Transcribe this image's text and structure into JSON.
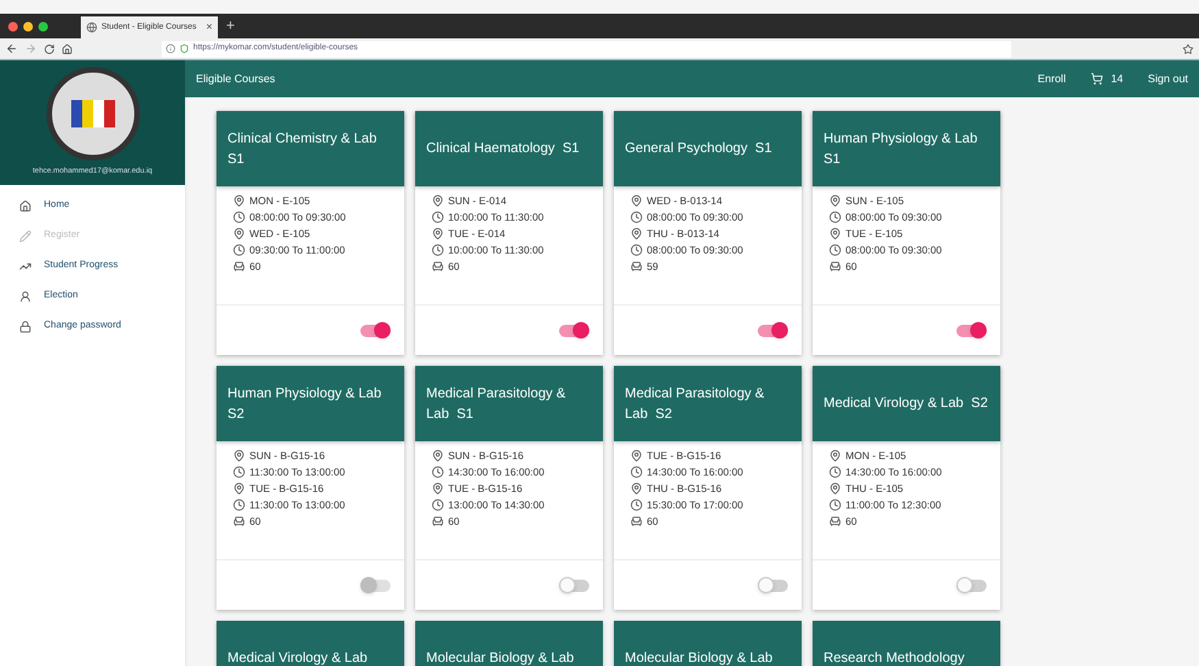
{
  "browser": {
    "tab_title": "Student - Eligible Courses",
    "tab_close": "×",
    "new_tab": "+",
    "url": "https://mykomar.com/student/eligible-courses"
  },
  "sidebar": {
    "email": "tehce.mohammed17@komar.edu.iq",
    "items": [
      {
        "label": "Home",
        "disabled": false
      },
      {
        "label": "Register",
        "disabled": true
      },
      {
        "label": "Student Progress",
        "disabled": false
      },
      {
        "label": "Election",
        "disabled": false
      },
      {
        "label": "Change password",
        "disabled": false
      }
    ]
  },
  "appbar": {
    "title": "Eligible Courses",
    "enroll": "Enroll",
    "cart_count": "14",
    "sign_out": "Sign out"
  },
  "courses": [
    {
      "title": "Clinical Chemistry & Lab  S1",
      "lines": [
        {
          "kind": "place",
          "text": "MON - E-105"
        },
        {
          "kind": "time",
          "text": "08:00:00 To 09:30:00"
        },
        {
          "kind": "place",
          "text": "WED - E-105"
        },
        {
          "kind": "time",
          "text": "09:30:00 To 11:00:00"
        },
        {
          "kind": "seats",
          "text": "60"
        }
      ],
      "on": true,
      "disabled": false
    },
    {
      "title": "Clinical Haematology  S1",
      "lines": [
        {
          "kind": "place",
          "text": "SUN - E-014"
        },
        {
          "kind": "time",
          "text": "10:00:00 To 11:30:00"
        },
        {
          "kind": "place",
          "text": "TUE - E-014"
        },
        {
          "kind": "time",
          "text": "10:00:00 To 11:30:00"
        },
        {
          "kind": "seats",
          "text": "60"
        }
      ],
      "on": true,
      "disabled": false
    },
    {
      "title": "General Psychology  S1",
      "lines": [
        {
          "kind": "place",
          "text": "WED - B-013-14"
        },
        {
          "kind": "time",
          "text": "08:00:00 To 09:30:00"
        },
        {
          "kind": "place",
          "text": "THU - B-013-14"
        },
        {
          "kind": "time",
          "text": "08:00:00 To 09:30:00"
        },
        {
          "kind": "seats",
          "text": "59"
        }
      ],
      "on": true,
      "disabled": false
    },
    {
      "title": "Human Physiology & Lab  S1",
      "lines": [
        {
          "kind": "place",
          "text": "SUN - E-105"
        },
        {
          "kind": "time",
          "text": "08:00:00 To 09:30:00"
        },
        {
          "kind": "place",
          "text": "TUE - E-105"
        },
        {
          "kind": "time",
          "text": "08:00:00 To 09:30:00"
        },
        {
          "kind": "seats",
          "text": "60"
        }
      ],
      "on": true,
      "disabled": false
    },
    {
      "title": "Human Physiology & Lab  S2",
      "lines": [
        {
          "kind": "place",
          "text": "SUN - B-G15-16"
        },
        {
          "kind": "time",
          "text": "11:30:00 To 13:00:00"
        },
        {
          "kind": "place",
          "text": "TUE - B-G15-16"
        },
        {
          "kind": "time",
          "text": "11:30:00 To 13:00:00"
        },
        {
          "kind": "seats",
          "text": "60"
        }
      ],
      "on": false,
      "disabled": true
    },
    {
      "title": "Medical Parasitology & Lab  S1",
      "lines": [
        {
          "kind": "place",
          "text": "SUN - B-G15-16"
        },
        {
          "kind": "time",
          "text": "14:30:00 To 16:00:00"
        },
        {
          "kind": "place",
          "text": "TUE - B-G15-16"
        },
        {
          "kind": "time",
          "text": "13:00:00 To 14:30:00"
        },
        {
          "kind": "seats",
          "text": "60"
        }
      ],
      "on": false,
      "disabled": false
    },
    {
      "title": "Medical Parasitology & Lab  S2",
      "lines": [
        {
          "kind": "place",
          "text": "TUE - B-G15-16"
        },
        {
          "kind": "time",
          "text": "14:30:00 To 16:00:00"
        },
        {
          "kind": "place",
          "text": "THU - B-G15-16"
        },
        {
          "kind": "time",
          "text": "15:30:00 To 17:00:00"
        },
        {
          "kind": "seats",
          "text": "60"
        }
      ],
      "on": false,
      "disabled": false
    },
    {
      "title": "Medical Virology & Lab  S2",
      "lines": [
        {
          "kind": "place",
          "text": "MON - E-105"
        },
        {
          "kind": "time",
          "text": "14:30:00 To 16:00:00"
        },
        {
          "kind": "place",
          "text": "THU - E-105"
        },
        {
          "kind": "time",
          "text": "11:00:00 To 12:30:00"
        },
        {
          "kind": "seats",
          "text": "60"
        }
      ],
      "on": false,
      "disabled": false
    },
    {
      "title": "Medical Virology & Lab"
    },
    {
      "title": "Molecular Biology & Lab"
    },
    {
      "title": "Molecular Biology & Lab"
    },
    {
      "title": "Research Methodology"
    }
  ]
}
